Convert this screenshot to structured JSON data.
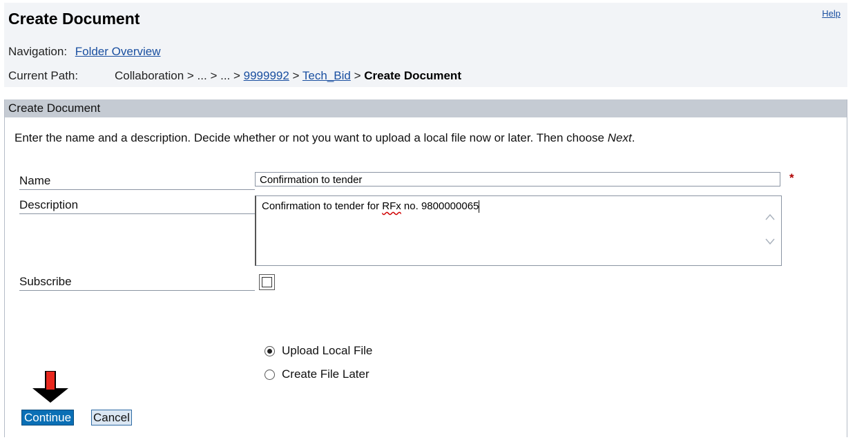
{
  "header": {
    "title": "Create Document",
    "help_label": "Help"
  },
  "navigation": {
    "label": "Navigation:",
    "link": "Folder Overview"
  },
  "path": {
    "label": "Current Path:",
    "prefix": "Collaboration > ... > ... > ",
    "link1": "9999992",
    "sep": " > ",
    "link2": "Tech_Bid",
    "sep2": " > ",
    "current": "Create Document"
  },
  "section": {
    "title": "Create Document",
    "instructions_prefix": "Enter the name and a description. Decide whether or not you want to upload a local file now or later. Then choose ",
    "instructions_emphasis": "Next",
    "instructions_suffix": "."
  },
  "form": {
    "name_label": "Name",
    "name_value": "Confirmation to tender",
    "required_mark": "*",
    "description_label": "Description",
    "description_before": "Confirmation to tender for ",
    "description_misspelled": "RFx",
    "description_after": " no. 9800000065",
    "subscribe_label": "Subscribe",
    "subscribe_checked": false,
    "upload_options": [
      {
        "label": "Upload Local File",
        "selected": true
      },
      {
        "label": "Create File Later",
        "selected": false
      }
    ]
  },
  "buttons": {
    "continue_label": "Continue",
    "cancel_label": "Cancel"
  },
  "annotation": {
    "arrow_icon": "down-arrow-icon",
    "arrow_fill": "#e8281e",
    "arrow_outline": "#000000"
  }
}
